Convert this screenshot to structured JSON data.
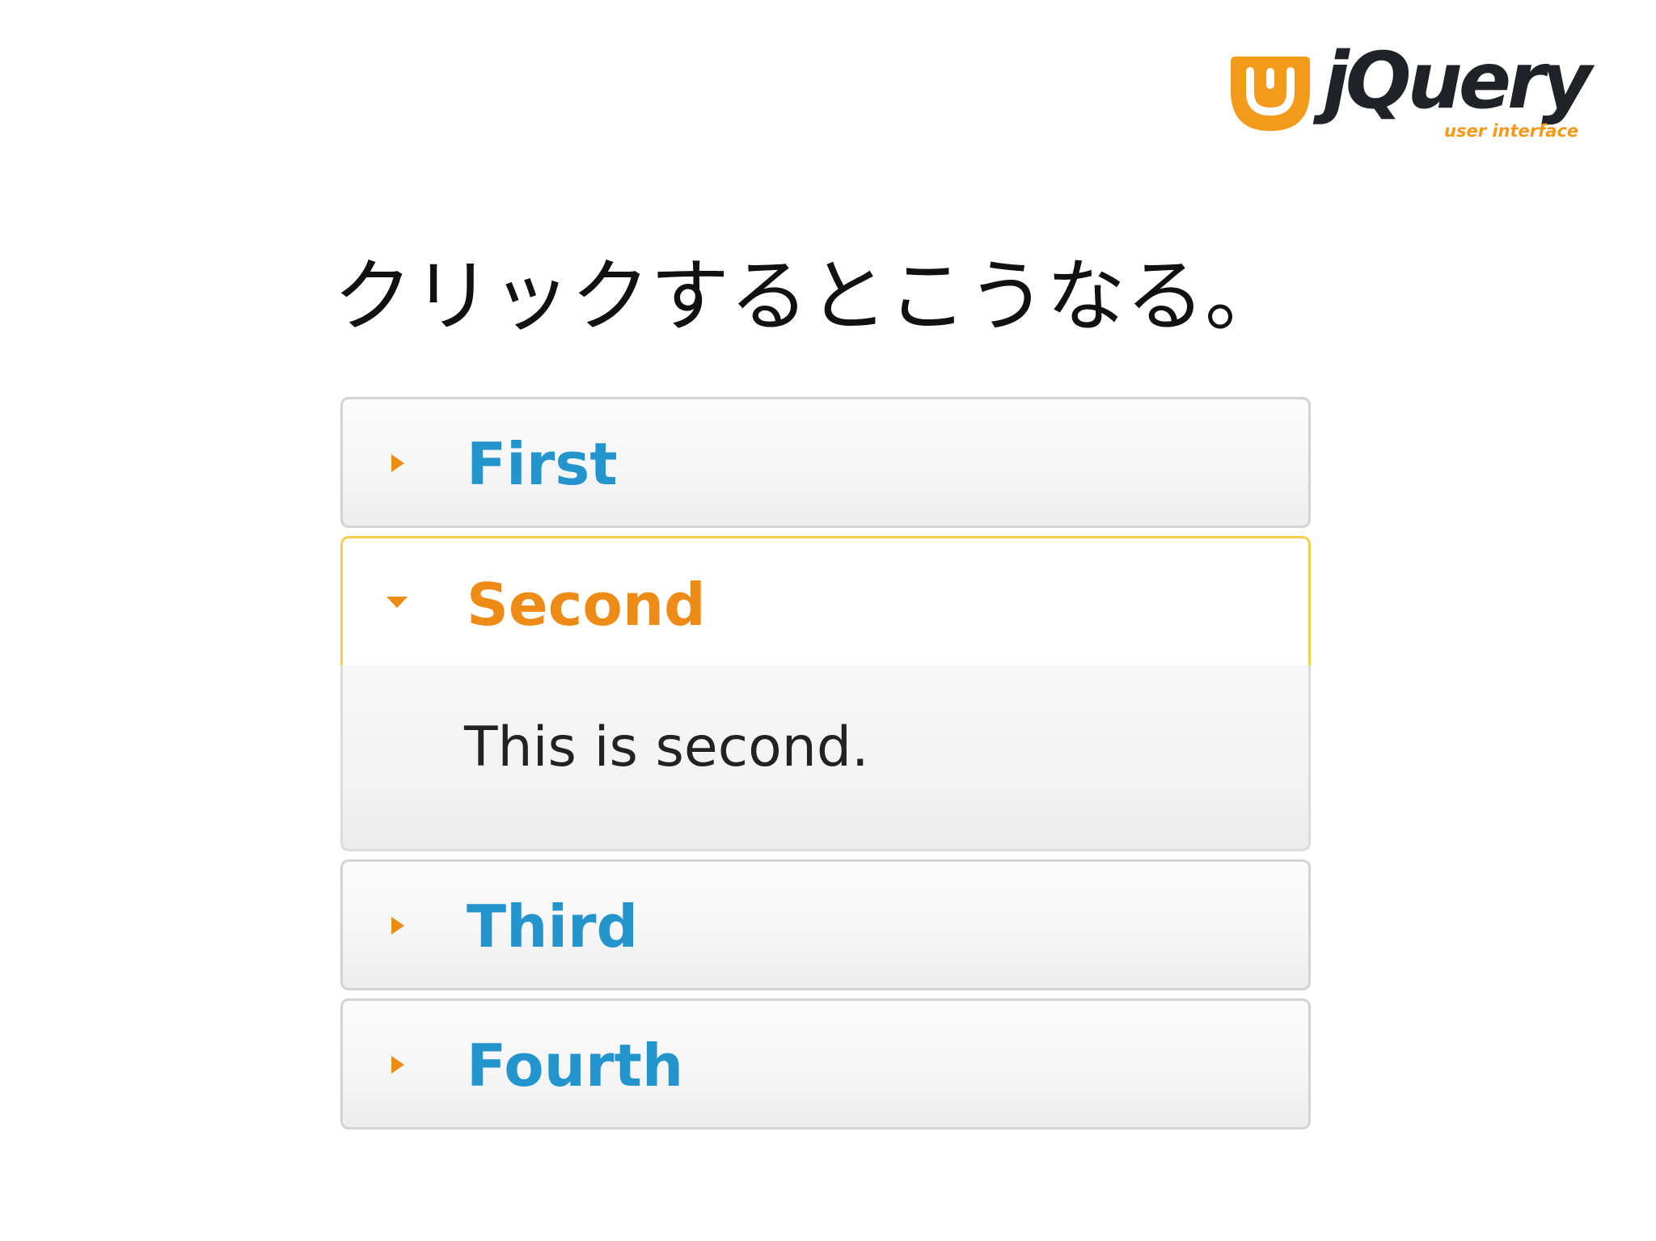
{
  "logo": {
    "wordmark": "jQuery",
    "tagline": "user interface",
    "brand_color": "#f39a1b",
    "icon": "jquery-ui-logo-icon"
  },
  "heading": "クリックするとこうなる。",
  "accordion": {
    "accent_color": "#2494cc",
    "active_color": "#ee8b16",
    "sections": [
      {
        "label": "First",
        "state": "collapsed",
        "icon": "triangle-right-icon"
      },
      {
        "label": "Second",
        "state": "expanded",
        "icon": "triangle-down-icon",
        "content": "This is second."
      },
      {
        "label": "Third",
        "state": "collapsed",
        "icon": "triangle-right-icon"
      },
      {
        "label": "Fourth",
        "state": "collapsed",
        "icon": "triangle-right-icon"
      }
    ]
  }
}
